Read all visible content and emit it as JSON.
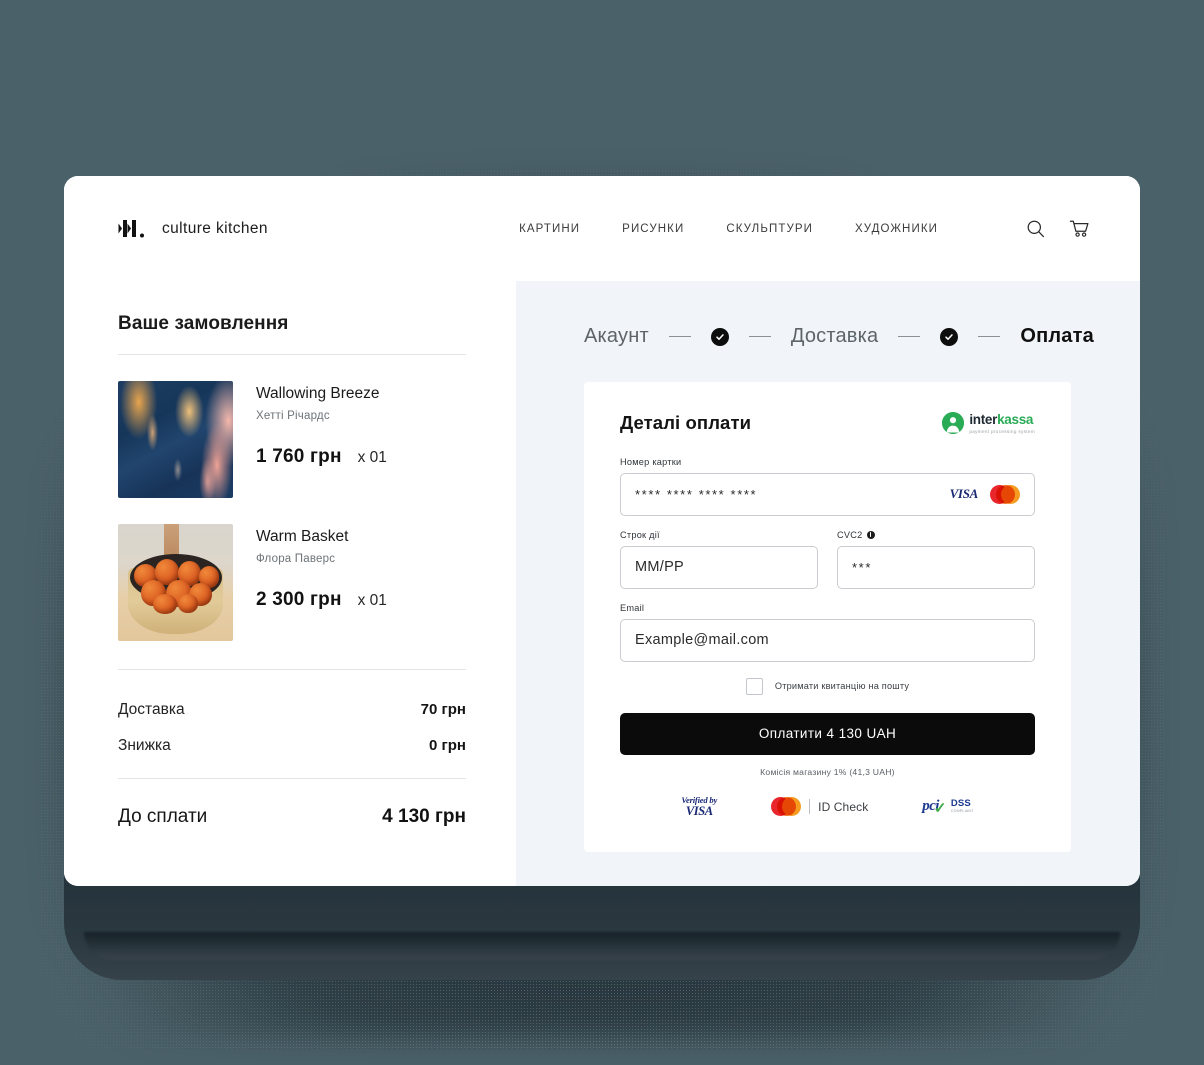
{
  "header": {
    "brand_name": "culture kitchen",
    "nav": [
      {
        "label": "КАРТИНИ"
      },
      {
        "label": "РИСУНКИ"
      },
      {
        "label": "СКУЛЬПТУРИ"
      },
      {
        "label": "ХУДОЖНИКИ"
      }
    ],
    "icons": {
      "search": "search-icon",
      "cart": "cart-icon"
    }
  },
  "order": {
    "title": "Ваше замовлення",
    "items": [
      {
        "name": "Wallowing Breeze",
        "author": "Хетті Річардс",
        "price": "1 760 грн",
        "qty": "x 01"
      },
      {
        "name": "Warm Basket",
        "author": "Флора Паверс",
        "price": "2 300 грн",
        "qty": "x 01"
      }
    ],
    "totals": [
      {
        "label": "Доставка",
        "value": "70 грн"
      },
      {
        "label": "Знижка",
        "value": "0 грн"
      }
    ],
    "grand_total": {
      "label": "До сплати",
      "value": "4 130 грн"
    }
  },
  "stepper": {
    "step1": "Акаунт",
    "step2": "Доставка",
    "step3": "Оплата"
  },
  "payment": {
    "title": "Деталі оплати",
    "provider": {
      "name_part1": "inter",
      "name_part2": "kassa",
      "tagline": "payment processing system"
    },
    "card_number": {
      "label": "Номер картки",
      "value": "**** **** **** ****",
      "brands": {
        "visa": "VISA",
        "mastercard": "mastercard-icon"
      }
    },
    "expiry": {
      "label": "Строк дії",
      "value": "ММ/РР"
    },
    "cvc": {
      "label": "CVC2",
      "value": "***",
      "info": "info-icon"
    },
    "email": {
      "label": "Email",
      "value": "Example@mail.com"
    },
    "receipt_checkbox": {
      "label": "Отримати квитанцію на пошту",
      "checked": false
    },
    "submit_label": "Оплатити 4 130 UAH",
    "fee_note": "Комісія магазину 1% (41,3 UAH)",
    "badges": {
      "visa_verified_line1": "Verified by",
      "visa_verified_line2": "VISA",
      "id_check": "ID Check",
      "pci_word": "pci",
      "pci_dss": "DSS",
      "pci_sub": "COMPLIANT"
    }
  },
  "colors": {
    "background": "#4b6169",
    "device": "#1e2c33",
    "panel": "#f1f5f9",
    "accent_black": "#0b0b0b",
    "provider_green": "#2aab56",
    "visa_navy": "#1a2975"
  }
}
